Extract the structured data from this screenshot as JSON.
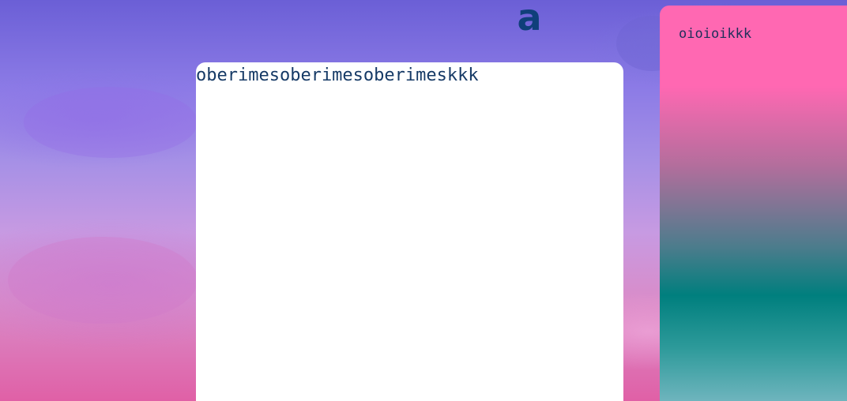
{
  "logo": {
    "glyph": "a",
    "icon": "letter-a-logo-icon",
    "color": "#0f3f7a"
  },
  "main": {
    "text": "oberimesoberimesoberimeskkk",
    "background": "#ffffff",
    "text_color": "#163a66"
  },
  "sidebar": {
    "text": "oioioikkk",
    "text_color": "#1d2f5a",
    "gradient_colors": [
      "#ff68b2",
      "#b26e9c",
      "#4c7c8c",
      "#007f7e",
      "#77b8c2"
    ]
  },
  "background": {
    "description_colors": [
      "#6b5fd6",
      "#a590e6",
      "#d98cc9",
      "#e060a6"
    ]
  }
}
